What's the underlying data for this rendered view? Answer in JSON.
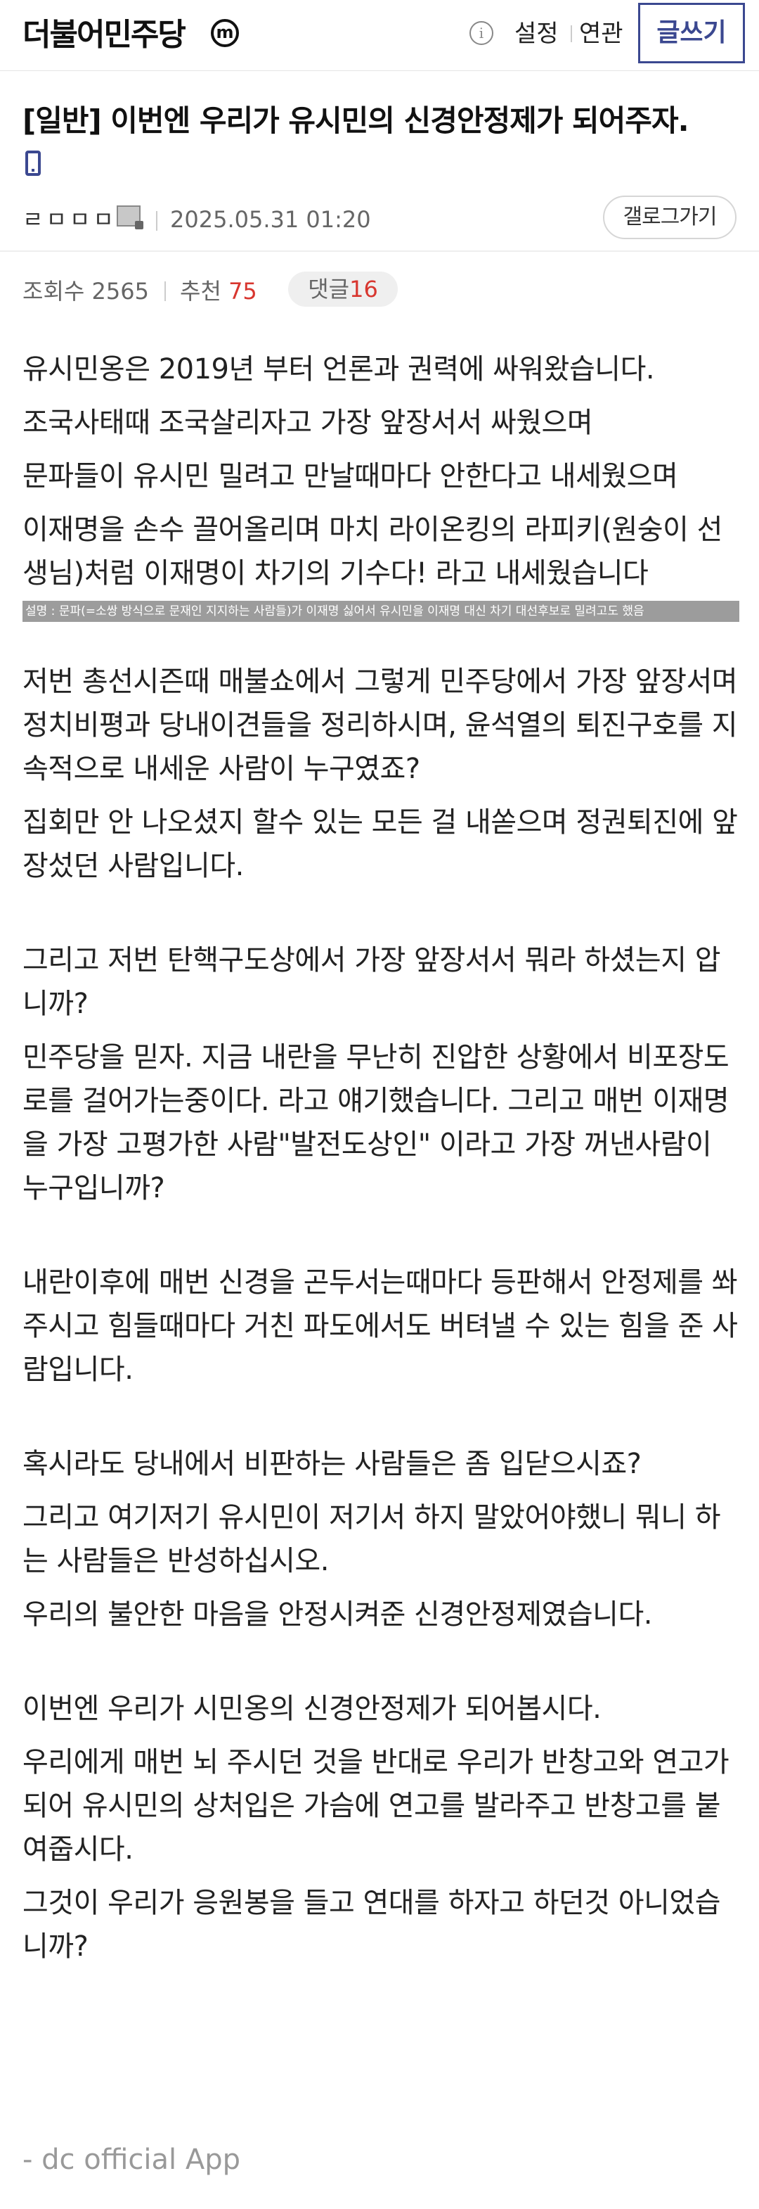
{
  "header": {
    "gallery_name": "더불어민주당",
    "minor_badge": "m",
    "info_icon": "info-icon",
    "settings_label": "설정",
    "related_label": "연관",
    "write_label": "글쓰기"
  },
  "post": {
    "title": "[일반] 이번엔 우리가 유시민의 신경안정제가 되어주자.",
    "device_icon": "mobile-phone-icon",
    "author": "ㄹㅁㅁㅁ",
    "author_icon": "fixed-nickname-icon",
    "date": "2025.05.31 01:20",
    "gallery_button": "갤로그가기",
    "views_label": "조회수 2565",
    "recommend_label": "추천",
    "recommend_count": "75",
    "comment_label": "댓글",
    "comment_count": "16"
  },
  "content": {
    "para1": [
      "유시민옹은 2019년 부터 언론과 권력에 싸워왔습니다.",
      "조국사태때 조국살리자고 가장 앞장서서 싸웠으며",
      "문파들이 유시민 밀려고 만날때마다 안한다고 내세웠으며",
      "이재명을 손수 끌어올리며 마치 라이온킹의 라피키(원숭이 선생님)처럼 이재명이 차기의 기수다! 라고 내세웠습니다"
    ],
    "caption": "설명 : 문파(=소쌍 방식으로 문재인 지지하는 사람들)가 이재명 싫어서 유시민을 이재명 대신 차기 대선후보로 밀려고도 했음",
    "para2": [
      "저번 총선시즌때 매불쇼에서 그렇게 민주당에서 가장 앞장서며 정치비평과 당내이견들을 정리하시며, 윤석열의 퇴진구호를 지속적으로 내세운 사람이 누구였죠?",
      "집회만 안 나오셨지 할수 있는 모든 걸 내쏟으며 정권퇴진에 앞장섰던 사람입니다."
    ],
    "para3": [
      "그리고 저번 탄핵구도상에서 가장 앞장서서 뭐라 하셨는지 압니까?",
      "민주당을 믿자. 지금 내란을 무난히 진압한 상황에서 비포장도로를 걸어가는중이다. 라고 얘기했습니다. 그리고 매번 이재명을 가장 고평가한 사람\"발전도상인\" 이라고 가장 꺼낸사람이 누구입니까?"
    ],
    "para4": [
      "내란이후에 매번 신경을 곤두서는때마다 등판해서 안정제를 쏴주시고 힘들때마다 거친 파도에서도 버텨낼 수 있는 힘을 준 사람입니다."
    ],
    "para5": [
      "혹시라도 당내에서 비판하는 사람들은 좀 입닫으시죠?",
      "그리고 여기저기 유시민이 저기서 하지 말았어야했니 뭐니 하는 사람들은 반성하십시오.",
      "우리의 불안한 마음을 안정시켜준 신경안정제였습니다."
    ],
    "para6": [
      "이번엔 우리가 시민옹의 신경안정제가 되어봅시다.",
      "우리에게 매번 뇌 주시던 것을 반대로 우리가 반창고와 연고가 되어 유시민의 상처입은 가슴에 연고를 발라주고 반창고를 붙여줍시다.",
      "그것이 우리가 응원봉을 들고 연대를 하자고 하던것 아니었습니까?"
    ]
  },
  "footer": {
    "app_label": "- dc official App"
  },
  "colors": {
    "brand": "#3b4890",
    "accent_red": "#d8362f",
    "muted": "#666666"
  }
}
